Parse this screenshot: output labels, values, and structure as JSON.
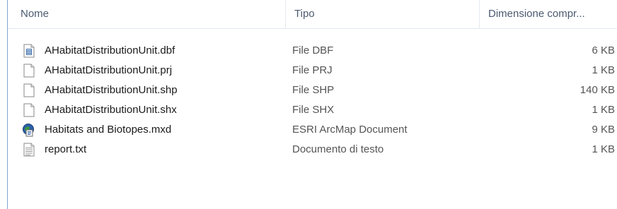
{
  "columns": {
    "name": "Nome",
    "type": "Tipo",
    "size": "Dimensione compr..."
  },
  "files": [
    {
      "name": "AHabitatDistributionUnit.dbf",
      "type": "File DBF",
      "size": "6 KB",
      "icon": "dbf-file-icon"
    },
    {
      "name": "AHabitatDistributionUnit.prj",
      "type": "File PRJ",
      "size": "1 KB",
      "icon": "blank-file-icon"
    },
    {
      "name": "AHabitatDistributionUnit.shp",
      "type": "File SHP",
      "size": "140 KB",
      "icon": "blank-file-icon"
    },
    {
      "name": "AHabitatDistributionUnit.shx",
      "type": "File SHX",
      "size": "1 KB",
      "icon": "blank-file-icon"
    },
    {
      "name": "Habitats and Biotopes.mxd",
      "type": "ESRI ArcMap Document",
      "size": "9 KB",
      "icon": "arcmap-document-icon"
    },
    {
      "name": "report.txt",
      "type": "Documento di testo",
      "size": "1 KB",
      "icon": "text-file-icon"
    }
  ],
  "colors": {
    "header_text": "#4b5a70",
    "border": "#7fa6cf",
    "arcmap_blue": "#2c5fa8",
    "arcmap_green": "#3a9a3a"
  }
}
